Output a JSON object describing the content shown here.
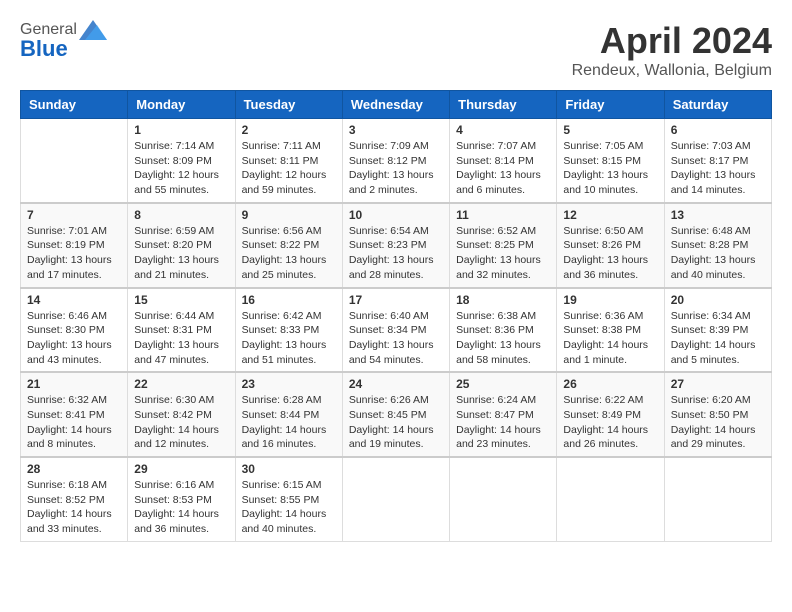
{
  "header": {
    "logo_general": "General",
    "logo_blue": "Blue",
    "title": "April 2024",
    "location": "Rendeux, Wallonia, Belgium"
  },
  "days_of_week": [
    "Sunday",
    "Monday",
    "Tuesday",
    "Wednesday",
    "Thursday",
    "Friday",
    "Saturday"
  ],
  "weeks": [
    [
      {
        "day": "",
        "info": ""
      },
      {
        "day": "1",
        "info": "Sunrise: 7:14 AM\nSunset: 8:09 PM\nDaylight: 12 hours\nand 55 minutes."
      },
      {
        "day": "2",
        "info": "Sunrise: 7:11 AM\nSunset: 8:11 PM\nDaylight: 12 hours\nand 59 minutes."
      },
      {
        "day": "3",
        "info": "Sunrise: 7:09 AM\nSunset: 8:12 PM\nDaylight: 13 hours\nand 2 minutes."
      },
      {
        "day": "4",
        "info": "Sunrise: 7:07 AM\nSunset: 8:14 PM\nDaylight: 13 hours\nand 6 minutes."
      },
      {
        "day": "5",
        "info": "Sunrise: 7:05 AM\nSunset: 8:15 PM\nDaylight: 13 hours\nand 10 minutes."
      },
      {
        "day": "6",
        "info": "Sunrise: 7:03 AM\nSunset: 8:17 PM\nDaylight: 13 hours\nand 14 minutes."
      }
    ],
    [
      {
        "day": "7",
        "info": "Sunrise: 7:01 AM\nSunset: 8:19 PM\nDaylight: 13 hours\nand 17 minutes."
      },
      {
        "day": "8",
        "info": "Sunrise: 6:59 AM\nSunset: 8:20 PM\nDaylight: 13 hours\nand 21 minutes."
      },
      {
        "day": "9",
        "info": "Sunrise: 6:56 AM\nSunset: 8:22 PM\nDaylight: 13 hours\nand 25 minutes."
      },
      {
        "day": "10",
        "info": "Sunrise: 6:54 AM\nSunset: 8:23 PM\nDaylight: 13 hours\nand 28 minutes."
      },
      {
        "day": "11",
        "info": "Sunrise: 6:52 AM\nSunset: 8:25 PM\nDaylight: 13 hours\nand 32 minutes."
      },
      {
        "day": "12",
        "info": "Sunrise: 6:50 AM\nSunset: 8:26 PM\nDaylight: 13 hours\nand 36 minutes."
      },
      {
        "day": "13",
        "info": "Sunrise: 6:48 AM\nSunset: 8:28 PM\nDaylight: 13 hours\nand 40 minutes."
      }
    ],
    [
      {
        "day": "14",
        "info": "Sunrise: 6:46 AM\nSunset: 8:30 PM\nDaylight: 13 hours\nand 43 minutes."
      },
      {
        "day": "15",
        "info": "Sunrise: 6:44 AM\nSunset: 8:31 PM\nDaylight: 13 hours\nand 47 minutes."
      },
      {
        "day": "16",
        "info": "Sunrise: 6:42 AM\nSunset: 8:33 PM\nDaylight: 13 hours\nand 51 minutes."
      },
      {
        "day": "17",
        "info": "Sunrise: 6:40 AM\nSunset: 8:34 PM\nDaylight: 13 hours\nand 54 minutes."
      },
      {
        "day": "18",
        "info": "Sunrise: 6:38 AM\nSunset: 8:36 PM\nDaylight: 13 hours\nand 58 minutes."
      },
      {
        "day": "19",
        "info": "Sunrise: 6:36 AM\nSunset: 8:38 PM\nDaylight: 14 hours\nand 1 minute."
      },
      {
        "day": "20",
        "info": "Sunrise: 6:34 AM\nSunset: 8:39 PM\nDaylight: 14 hours\nand 5 minutes."
      }
    ],
    [
      {
        "day": "21",
        "info": "Sunrise: 6:32 AM\nSunset: 8:41 PM\nDaylight: 14 hours\nand 8 minutes."
      },
      {
        "day": "22",
        "info": "Sunrise: 6:30 AM\nSunset: 8:42 PM\nDaylight: 14 hours\nand 12 minutes."
      },
      {
        "day": "23",
        "info": "Sunrise: 6:28 AM\nSunset: 8:44 PM\nDaylight: 14 hours\nand 16 minutes."
      },
      {
        "day": "24",
        "info": "Sunrise: 6:26 AM\nSunset: 8:45 PM\nDaylight: 14 hours\nand 19 minutes."
      },
      {
        "day": "25",
        "info": "Sunrise: 6:24 AM\nSunset: 8:47 PM\nDaylight: 14 hours\nand 23 minutes."
      },
      {
        "day": "26",
        "info": "Sunrise: 6:22 AM\nSunset: 8:49 PM\nDaylight: 14 hours\nand 26 minutes."
      },
      {
        "day": "27",
        "info": "Sunrise: 6:20 AM\nSunset: 8:50 PM\nDaylight: 14 hours\nand 29 minutes."
      }
    ],
    [
      {
        "day": "28",
        "info": "Sunrise: 6:18 AM\nSunset: 8:52 PM\nDaylight: 14 hours\nand 33 minutes."
      },
      {
        "day": "29",
        "info": "Sunrise: 6:16 AM\nSunset: 8:53 PM\nDaylight: 14 hours\nand 36 minutes."
      },
      {
        "day": "30",
        "info": "Sunrise: 6:15 AM\nSunset: 8:55 PM\nDaylight: 14 hours\nand 40 minutes."
      },
      {
        "day": "",
        "info": ""
      },
      {
        "day": "",
        "info": ""
      },
      {
        "day": "",
        "info": ""
      },
      {
        "day": "",
        "info": ""
      }
    ]
  ]
}
